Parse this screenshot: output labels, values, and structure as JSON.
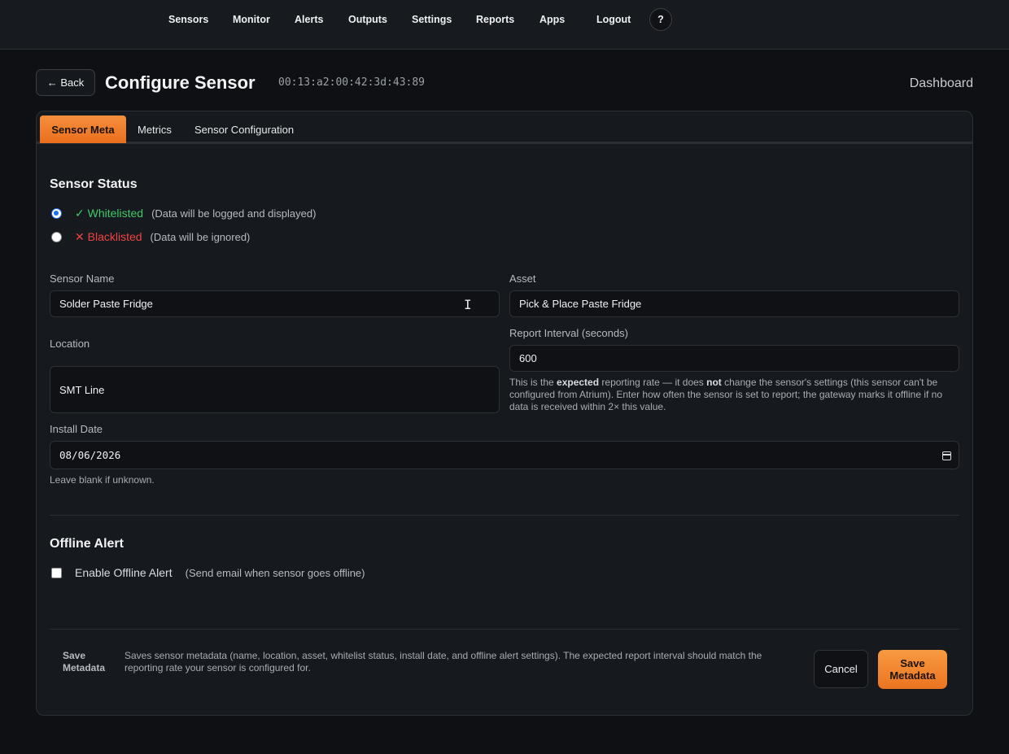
{
  "nav": {
    "items": [
      "Sensors",
      "Monitor",
      "Alerts",
      "Outputs",
      "Settings",
      "Reports",
      "Apps",
      "Logout"
    ],
    "help": "?"
  },
  "header": {
    "back_label": "← Back",
    "title": "Configure Sensor",
    "mac": "00:13:a2:00:42:3d:43:89",
    "dashboard": "Dashboard"
  },
  "tabs": [
    "Sensor Meta",
    "Metrics",
    "Sensor Configuration"
  ],
  "sensor_status": {
    "title": "Sensor Status",
    "options": [
      {
        "label": "✓ Whitelisted",
        "desc": "(Data will be logged and displayed)",
        "checked": true
      },
      {
        "label": "✕ Blacklisted",
        "desc": "(Data will be ignored)",
        "checked": false
      }
    ]
  },
  "fields": {
    "sensor_name": {
      "label": "Sensor Name",
      "value": "Solder Paste Fridge"
    },
    "asset": {
      "label": "Asset",
      "value": "Pick & Place Paste Fridge"
    },
    "location": {
      "label": "Location",
      "value": "SMT Line"
    },
    "report_interval": {
      "label": "Report Interval (seconds)",
      "value": "600",
      "help_pre": "This is the ",
      "help_b1": "expected",
      "help_mid": " reporting rate — it does ",
      "help_b2": "not",
      "help_post": " change the sensor's settings (this sensor can't be configured from Atrium). Enter how often the sensor is set to report; the gateway marks it offline if no data is received within 2× this value."
    },
    "install_date": {
      "label": "Install Date",
      "value": "08/06/2026",
      "help": "Leave blank if unknown."
    }
  },
  "offline_alert": {
    "title": "Offline Alert",
    "checkbox_label": "Enable Offline Alert",
    "desc": "(Send email when sensor goes offline)",
    "checked": false
  },
  "footer": {
    "label": "Save Metadata",
    "desc": "Saves sensor metadata (name, location, asset, whitelist status, install date, and offline alert settings). The expected report interval should match the reporting rate your sensor is configured for.",
    "cancel": "Cancel",
    "save": "Save Metadata"
  }
}
